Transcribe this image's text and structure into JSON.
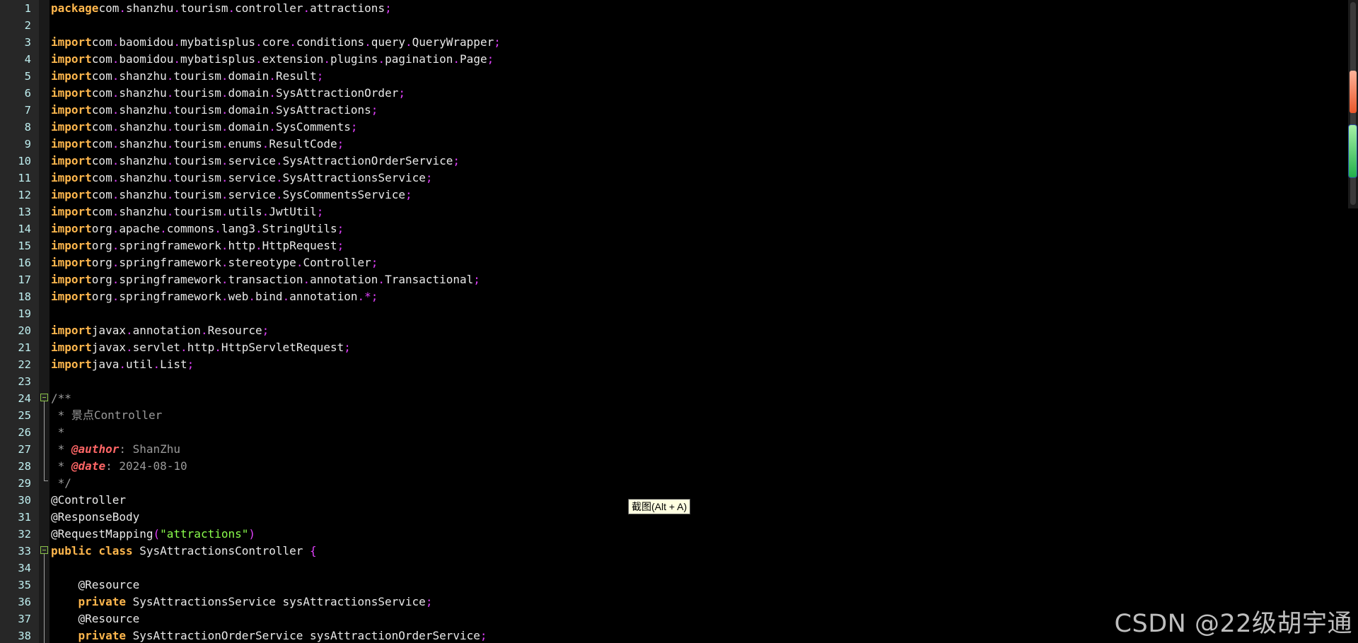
{
  "editor": {
    "lines": [
      {
        "n": "1",
        "tokens": [
          [
            "kw",
            "package"
          ],
          [
            "",
            "com"
          ],
          [
            "dot",
            "."
          ],
          [
            "",
            "shanzhu"
          ],
          [
            "dot",
            "."
          ],
          [
            "",
            "tourism"
          ],
          [
            "dot",
            "."
          ],
          [
            "",
            "controller"
          ],
          [
            "dot",
            "."
          ],
          [
            "",
            "attractions"
          ],
          [
            "dot",
            ";"
          ]
        ]
      },
      {
        "n": "2",
        "tokens": []
      },
      {
        "n": "3",
        "tokens": [
          [
            "kw",
            "import"
          ],
          [
            "",
            "com"
          ],
          [
            "dot",
            "."
          ],
          [
            "",
            "baomidou"
          ],
          [
            "dot",
            "."
          ],
          [
            "",
            "mybatisplus"
          ],
          [
            "dot",
            "."
          ],
          [
            "",
            "core"
          ],
          [
            "dot",
            "."
          ],
          [
            "",
            "conditions"
          ],
          [
            "dot",
            "."
          ],
          [
            "",
            "query"
          ],
          [
            "dot",
            "."
          ],
          [
            "",
            "QueryWrapper"
          ],
          [
            "dot",
            ";"
          ]
        ]
      },
      {
        "n": "4",
        "tokens": [
          [
            "kw",
            "import"
          ],
          [
            "",
            "com"
          ],
          [
            "dot",
            "."
          ],
          [
            "",
            "baomidou"
          ],
          [
            "dot",
            "."
          ],
          [
            "",
            "mybatisplus"
          ],
          [
            "dot",
            "."
          ],
          [
            "",
            "extension"
          ],
          [
            "dot",
            "."
          ],
          [
            "",
            "plugins"
          ],
          [
            "dot",
            "."
          ],
          [
            "",
            "pagination"
          ],
          [
            "dot",
            "."
          ],
          [
            "",
            "Page"
          ],
          [
            "dot",
            ";"
          ]
        ]
      },
      {
        "n": "5",
        "tokens": [
          [
            "kw",
            "import"
          ],
          [
            "",
            "com"
          ],
          [
            "dot",
            "."
          ],
          [
            "",
            "shanzhu"
          ],
          [
            "dot",
            "."
          ],
          [
            "",
            "tourism"
          ],
          [
            "dot",
            "."
          ],
          [
            "",
            "domain"
          ],
          [
            "dot",
            "."
          ],
          [
            "",
            "Result"
          ],
          [
            "dot",
            ";"
          ]
        ]
      },
      {
        "n": "6",
        "tokens": [
          [
            "kw",
            "import"
          ],
          [
            "",
            "com"
          ],
          [
            "dot",
            "."
          ],
          [
            "",
            "shanzhu"
          ],
          [
            "dot",
            "."
          ],
          [
            "",
            "tourism"
          ],
          [
            "dot",
            "."
          ],
          [
            "",
            "domain"
          ],
          [
            "dot",
            "."
          ],
          [
            "",
            "SysAttractionOrder"
          ],
          [
            "dot",
            ";"
          ]
        ]
      },
      {
        "n": "7",
        "tokens": [
          [
            "kw",
            "import"
          ],
          [
            "",
            "com"
          ],
          [
            "dot",
            "."
          ],
          [
            "",
            "shanzhu"
          ],
          [
            "dot",
            "."
          ],
          [
            "",
            "tourism"
          ],
          [
            "dot",
            "."
          ],
          [
            "",
            "domain"
          ],
          [
            "dot",
            "."
          ],
          [
            "",
            "SysAttractions"
          ],
          [
            "dot",
            ";"
          ]
        ]
      },
      {
        "n": "8",
        "tokens": [
          [
            "kw",
            "import"
          ],
          [
            "",
            "com"
          ],
          [
            "dot",
            "."
          ],
          [
            "",
            "shanzhu"
          ],
          [
            "dot",
            "."
          ],
          [
            "",
            "tourism"
          ],
          [
            "dot",
            "."
          ],
          [
            "",
            "domain"
          ],
          [
            "dot",
            "."
          ],
          [
            "",
            "SysComments"
          ],
          [
            "dot",
            ";"
          ]
        ]
      },
      {
        "n": "9",
        "tokens": [
          [
            "kw",
            "import"
          ],
          [
            "",
            "com"
          ],
          [
            "dot",
            "."
          ],
          [
            "",
            "shanzhu"
          ],
          [
            "dot",
            "."
          ],
          [
            "",
            "tourism"
          ],
          [
            "dot",
            "."
          ],
          [
            "",
            "enums"
          ],
          [
            "dot",
            "."
          ],
          [
            "",
            "ResultCode"
          ],
          [
            "dot",
            ";"
          ]
        ]
      },
      {
        "n": "10",
        "tokens": [
          [
            "kw",
            "import"
          ],
          [
            "",
            "com"
          ],
          [
            "dot",
            "."
          ],
          [
            "",
            "shanzhu"
          ],
          [
            "dot",
            "."
          ],
          [
            "",
            "tourism"
          ],
          [
            "dot",
            "."
          ],
          [
            "",
            "service"
          ],
          [
            "dot",
            "."
          ],
          [
            "",
            "SysAttractionOrderService"
          ],
          [
            "dot",
            ";"
          ]
        ]
      },
      {
        "n": "11",
        "tokens": [
          [
            "kw",
            "import"
          ],
          [
            "",
            "com"
          ],
          [
            "dot",
            "."
          ],
          [
            "",
            "shanzhu"
          ],
          [
            "dot",
            "."
          ],
          [
            "",
            "tourism"
          ],
          [
            "dot",
            "."
          ],
          [
            "",
            "service"
          ],
          [
            "dot",
            "."
          ],
          [
            "",
            "SysAttractionsService"
          ],
          [
            "dot",
            ";"
          ]
        ]
      },
      {
        "n": "12",
        "tokens": [
          [
            "kw",
            "import"
          ],
          [
            "",
            "com"
          ],
          [
            "dot",
            "."
          ],
          [
            "",
            "shanzhu"
          ],
          [
            "dot",
            "."
          ],
          [
            "",
            "tourism"
          ],
          [
            "dot",
            "."
          ],
          [
            "",
            "service"
          ],
          [
            "dot",
            "."
          ],
          [
            "",
            "SysCommentsService"
          ],
          [
            "dot",
            ";"
          ]
        ]
      },
      {
        "n": "13",
        "tokens": [
          [
            "kw",
            "import"
          ],
          [
            "",
            "com"
          ],
          [
            "dot",
            "."
          ],
          [
            "",
            "shanzhu"
          ],
          [
            "dot",
            "."
          ],
          [
            "",
            "tourism"
          ],
          [
            "dot",
            "."
          ],
          [
            "",
            "utils"
          ],
          [
            "dot",
            "."
          ],
          [
            "",
            "JwtUtil"
          ],
          [
            "dot",
            ";"
          ]
        ]
      },
      {
        "n": "14",
        "tokens": [
          [
            "kw",
            "import"
          ],
          [
            "",
            "org"
          ],
          [
            "dot",
            "."
          ],
          [
            "",
            "apache"
          ],
          [
            "dot",
            "."
          ],
          [
            "",
            "commons"
          ],
          [
            "dot",
            "."
          ],
          [
            "",
            "lang3"
          ],
          [
            "dot",
            "."
          ],
          [
            "",
            "StringUtils"
          ],
          [
            "dot",
            ";"
          ]
        ]
      },
      {
        "n": "15",
        "tokens": [
          [
            "kw",
            "import"
          ],
          [
            "",
            "org"
          ],
          [
            "dot",
            "."
          ],
          [
            "",
            "springframework"
          ],
          [
            "dot",
            "."
          ],
          [
            "",
            "http"
          ],
          [
            "dot",
            "."
          ],
          [
            "",
            "HttpRequest"
          ],
          [
            "dot",
            ";"
          ]
        ]
      },
      {
        "n": "16",
        "tokens": [
          [
            "kw",
            "import"
          ],
          [
            "",
            "org"
          ],
          [
            "dot",
            "."
          ],
          [
            "",
            "springframework"
          ],
          [
            "dot",
            "."
          ],
          [
            "",
            "stereotype"
          ],
          [
            "dot",
            "."
          ],
          [
            "",
            "Controller"
          ],
          [
            "dot",
            ";"
          ]
        ]
      },
      {
        "n": "17",
        "tokens": [
          [
            "kw",
            "import"
          ],
          [
            "",
            "org"
          ],
          [
            "dot",
            "."
          ],
          [
            "",
            "springframework"
          ],
          [
            "dot",
            "."
          ],
          [
            "",
            "transaction"
          ],
          [
            "dot",
            "."
          ],
          [
            "",
            "annotation"
          ],
          [
            "dot",
            "."
          ],
          [
            "",
            "Transactional"
          ],
          [
            "dot",
            ";"
          ]
        ]
      },
      {
        "n": "18",
        "tokens": [
          [
            "kw",
            "import"
          ],
          [
            "",
            "org"
          ],
          [
            "dot",
            "."
          ],
          [
            "",
            "springframework"
          ],
          [
            "dot",
            "."
          ],
          [
            "",
            "web"
          ],
          [
            "dot",
            "."
          ],
          [
            "",
            "bind"
          ],
          [
            "dot",
            "."
          ],
          [
            "",
            "annotation"
          ],
          [
            "dot",
            ".*;"
          ]
        ]
      },
      {
        "n": "19",
        "tokens": []
      },
      {
        "n": "20",
        "tokens": [
          [
            "kw",
            "import"
          ],
          [
            "",
            "javax"
          ],
          [
            "dot",
            "."
          ],
          [
            "",
            "annotation"
          ],
          [
            "dot",
            "."
          ],
          [
            "",
            "Resource"
          ],
          [
            "dot",
            ";"
          ]
        ]
      },
      {
        "n": "21",
        "tokens": [
          [
            "kw",
            "import"
          ],
          [
            "",
            "javax"
          ],
          [
            "dot",
            "."
          ],
          [
            "",
            "servlet"
          ],
          [
            "dot",
            "."
          ],
          [
            "",
            "http"
          ],
          [
            "dot",
            "."
          ],
          [
            "",
            "HttpServletRequest"
          ],
          [
            "dot",
            ";"
          ]
        ]
      },
      {
        "n": "22",
        "tokens": [
          [
            "kw",
            "import"
          ],
          [
            "",
            "java"
          ],
          [
            "dot",
            "."
          ],
          [
            "",
            "util"
          ],
          [
            "dot",
            "."
          ],
          [
            "",
            "List"
          ],
          [
            "dot",
            ";"
          ]
        ]
      },
      {
        "n": "23",
        "tokens": []
      },
      {
        "n": "24",
        "tokens": [
          [
            "cmt",
            "/**"
          ]
        ]
      },
      {
        "n": "25",
        "tokens": [
          [
            "cmt",
            " * 景点Controller"
          ]
        ]
      },
      {
        "n": "26",
        "tokens": [
          [
            "cmt",
            " *"
          ]
        ]
      },
      {
        "n": "27",
        "tokens": [
          [
            "cmt",
            " * "
          ],
          [
            "tag",
            "@author"
          ],
          [
            "cmt",
            ": ShanZhu"
          ]
        ]
      },
      {
        "n": "28",
        "tokens": [
          [
            "cmt",
            " * "
          ],
          [
            "tag",
            "@date"
          ],
          [
            "cmt",
            ": 2024-08-10"
          ]
        ]
      },
      {
        "n": "29",
        "tokens": [
          [
            "cmt",
            " */"
          ]
        ]
      },
      {
        "n": "30",
        "tokens": [
          [
            "",
            "@Controller"
          ]
        ]
      },
      {
        "n": "31",
        "tokens": [
          [
            "",
            "@ResponseBody"
          ]
        ]
      },
      {
        "n": "32",
        "tokens": [
          [
            "",
            "@RequestMapping"
          ],
          [
            "dot",
            "("
          ],
          [
            "str",
            "\"attractions\""
          ],
          [
            "dot",
            ")"
          ]
        ]
      },
      {
        "n": "33",
        "tokens": [
          [
            "kw",
            "public class"
          ],
          [
            "",
            " SysAttractionsController "
          ],
          [
            "brace",
            "{"
          ]
        ]
      },
      {
        "n": "34",
        "tokens": []
      },
      {
        "n": "35",
        "tokens": [
          [
            "",
            "    @Resource"
          ]
        ]
      },
      {
        "n": "36",
        "tokens": [
          [
            "kw",
            "    private"
          ],
          [
            "",
            " SysAttractionsService sysAttractionsService"
          ],
          [
            "dot",
            ";"
          ]
        ]
      },
      {
        "n": "37",
        "tokens": [
          [
            "",
            "    @Resource"
          ]
        ]
      },
      {
        "n": "38",
        "tokens": [
          [
            "kw",
            "    private"
          ],
          [
            "",
            " SysAttractionOrderService sysAttractionOrderService"
          ],
          [
            "dot",
            ";"
          ]
        ]
      }
    ]
  },
  "tooltip": {
    "text": "截图(Alt + A)"
  },
  "watermark": {
    "text": "CSDN @22级胡宇通"
  },
  "colors": {
    "background": "#000000",
    "keyword": "#ffb74d",
    "punctuation": "#e040fb",
    "string": "#8bff4d",
    "comment": "#9a9a9a",
    "javadoc_tag": "#ff6666",
    "line_number": "#bfeff0"
  },
  "icons": {
    "fold_marker": "fold-minus-icon"
  }
}
